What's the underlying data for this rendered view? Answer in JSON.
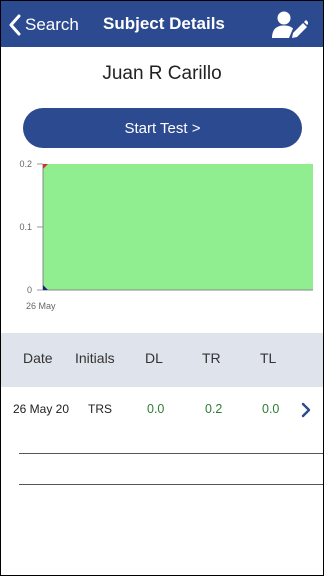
{
  "nav": {
    "back_label": "Search",
    "title": "Subject Details"
  },
  "subject": {
    "name": "Juan R Carillo"
  },
  "actions": {
    "start_test_label": "Start Test >"
  },
  "chart_data": {
    "type": "area",
    "x": [
      "26 May"
    ],
    "yticks": [
      "0.2",
      "0.1",
      "0"
    ],
    "ylim": [
      0,
      0.2
    ],
    "fill_color": "#90ee90",
    "title": "",
    "xlabel": "",
    "ylabel": ""
  },
  "table": {
    "columns": [
      "Date",
      "Initials",
      "DL",
      "TR",
      "TL"
    ],
    "rows": [
      {
        "date": "26 May 20",
        "initials": "TRS",
        "dl": "0.0",
        "tr": "0.2",
        "tl": "0.0"
      }
    ]
  },
  "colors": {
    "brand": "#2c4a8f",
    "value_green": "#2e7d32",
    "header_bg": "#dfe3ec"
  },
  "icons": {
    "back": "chevron-left-icon",
    "user": "user-edit-icon",
    "row": "chevron-right-icon"
  }
}
